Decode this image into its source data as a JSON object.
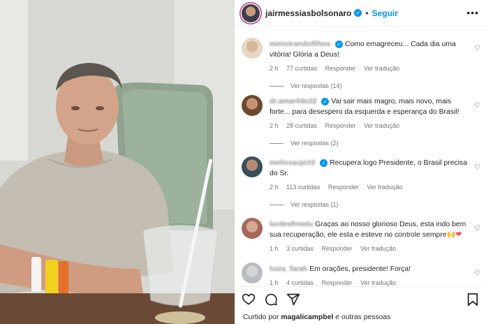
{
  "header": {
    "username": "jairmessiasbolsonaro",
    "separator": "•",
    "follow_label": "Seguir",
    "more_icon": "more-horizontal-icon"
  },
  "comments": [
    {
      "user": "ministrandofilhos",
      "text": "Como emagreceu... Cada dia uma vitória! Glória a Deus!",
      "time": "2 h",
      "likes": "77 curtidas",
      "reply": "Responder",
      "translate": "Ver tradução",
      "replies": "Ver respostas (14)",
      "avatar_color": "#e8d7c3"
    },
    {
      "user": "dr.amarildo22",
      "text": "Vai sair mais magro, mais novo, mais forte... para desespero da esquerda e esperança do Brasil!",
      "time": "2 h",
      "likes": "28 curtidas",
      "reply": "Responder",
      "translate": "Ver tradução",
      "replies": "Ver respostas (2)",
      "avatar_color": "#6b4a2f"
    },
    {
      "user": "melissaujo10",
      "text": "Recupera logo Presidente, o Brasil precisa do Sr.",
      "time": "2 h",
      "likes": "113 curtidas",
      "reply": "Responder",
      "translate": "Ver tradução",
      "replies": "Ver respostas (1)",
      "avatar_color": "#3a4d5c"
    },
    {
      "user": "lurdesfreielu",
      "text": "Graças ao nosso glorioso Deus, esta indo bem sua recuperação, ele esta e esteve no controle sempre🙌",
      "emoji_end": "❤",
      "time": "1 h",
      "likes": "3 curtidas",
      "reply": "Responder",
      "translate": "Ver tradução",
      "avatar_color": "#a5675a"
    },
    {
      "user": "luiza_farah",
      "text": "Em orações, presidente! Força!",
      "time": "1 h",
      "likes": "4 curtidas",
      "reply": "Responder",
      "translate": "Ver tradução",
      "avatar_color": "#b8bcc0"
    }
  ],
  "footer": {
    "liked_prefix": "Curtido por ",
    "liked_user": "magalicampbel",
    "liked_suffix": " e outras pessoas",
    "icons": [
      "heart-icon",
      "comment-icon",
      "share-icon",
      "save-icon"
    ]
  },
  "colors": {
    "link": "#0095f6",
    "text": "#262626",
    "muted": "#737373",
    "red_heart": "#ed4956"
  }
}
